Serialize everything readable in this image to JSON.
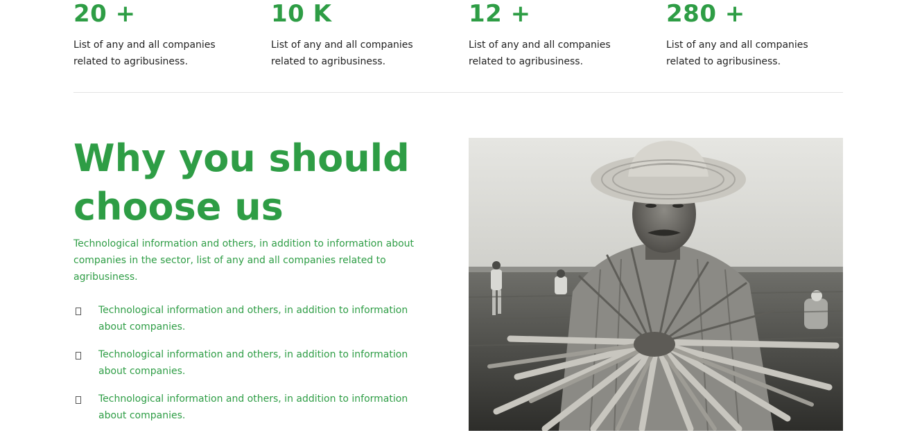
{
  "stats": [
    {
      "number": "20 +",
      "description": "List of any and all companies related to agribusiness."
    },
    {
      "number": "10 K",
      "description": "List of any and all companies related to agribusiness."
    },
    {
      "number": "12 +",
      "description": "List of any and all companies related to agribusiness."
    },
    {
      "number": "280 +",
      "description": "List of any and all companies related to agribusiness."
    }
  ],
  "why": {
    "title": "Why you should choose us",
    "intro": "Technological information and others, in addition to information about companies in the sector, list of any and all companies related to agribusiness.",
    "features": [
      {
        "icon": "checkbox-icon",
        "text": "Technological information and others, in addition to information about companies."
      },
      {
        "icon": "checkbox-icon",
        "text": "Technological information and others, in addition to information about companies."
      },
      {
        "icon": "checkbox-icon",
        "text": "Technological information and others, in addition to information about companies."
      }
    ]
  },
  "photo": {
    "subject": "farmer-holding-carrots-photo"
  },
  "colors": {
    "accent": "#2e9d45",
    "text": "#222222",
    "divider": "#e3e3e3"
  }
}
